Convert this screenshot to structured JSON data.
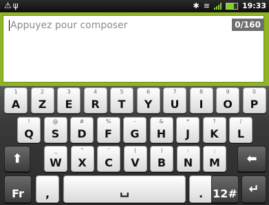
{
  "status_bar": {
    "left_icons": [
      "warning-icon",
      "usb-icon"
    ],
    "time": "19:33"
  },
  "composer": {
    "placeholder": "Appuyez pour composer",
    "counter": "0/160"
  },
  "keyboard": {
    "row1": [
      {
        "main": "A",
        "alt": "1"
      },
      {
        "main": "Z",
        "alt": "2"
      },
      {
        "main": "E",
        "alt": "3"
      },
      {
        "main": "R",
        "alt": "4"
      },
      {
        "main": "T",
        "alt": "5"
      },
      {
        "main": "Y",
        "alt": "6"
      },
      {
        "main": "U",
        "alt": "7"
      },
      {
        "main": "I",
        "alt": "8"
      },
      {
        "main": "O",
        "alt": "9"
      },
      {
        "main": "P",
        "alt": "0"
      }
    ],
    "row2": [
      {
        "main": "Q",
        "alt": "!"
      },
      {
        "main": "S",
        "alt": "@"
      },
      {
        "main": "D",
        "alt": "#"
      },
      {
        "main": "F",
        "alt": "%"
      },
      {
        "main": "G",
        "alt": "-"
      },
      {
        "main": "H",
        "alt": "&"
      },
      {
        "main": "J",
        "alt": "*"
      },
      {
        "main": "K",
        "alt": "?"
      },
      {
        "main": "L",
        "alt": "/"
      }
    ],
    "row3": [
      {
        "main": "W",
        "alt": "_"
      },
      {
        "main": "X",
        "alt": "\""
      },
      {
        "main": "C",
        "alt": "'"
      },
      {
        "main": "V",
        "alt": "("
      },
      {
        "main": "B",
        "alt": ")"
      },
      {
        "main": "N",
        "alt": ":"
      },
      {
        "main": "M",
        "alt": ";"
      }
    ],
    "lang_key": "Fr",
    "comma_key": ",",
    "period_key": ".",
    "num_key": "12#"
  },
  "colors": {
    "composer_accent": "#8fb524",
    "counter_bg": "#6e6e6e"
  }
}
